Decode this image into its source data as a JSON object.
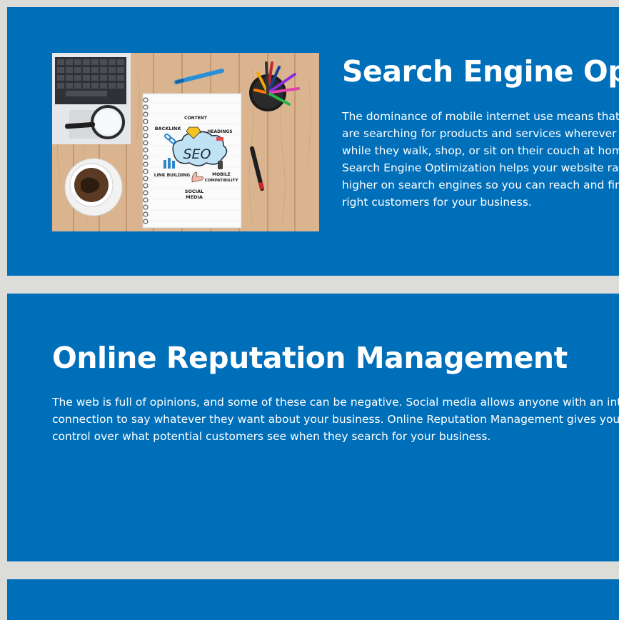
{
  "services": [
    {
      "title": "Search Engine Optimization",
      "body": "The dominance of mobile internet use means that people are searching for products and services wherever they go: while they walk, shop, or sit on their couch at home. Search Engine Optimization helps your website rank higher on search engines so you can reach and find the right customers for your business.",
      "image": {
        "labels": {
          "content": "CONTENT",
          "backlink": "BACKLINK",
          "headings": "HEADINGS",
          "seo": "SEO",
          "link_building": "LINK BUILDING",
          "mobile": "MOBILE",
          "compatibility": "COMPATIBILITY",
          "social": "SOCIAL",
          "media": "MEDIA"
        }
      }
    },
    {
      "title": "Online Reputation Management",
      "body": "The web is full of opinions, and some of these can be negative. Social media allows anyone with an internet connection to say whatever they want about your business. Online Reputation Management gives you control over what potential customers see when they search for your business."
    }
  ],
  "colors": {
    "page_background": "#dcdcd8",
    "card_background": "#006fba",
    "text": "#ffffff"
  }
}
